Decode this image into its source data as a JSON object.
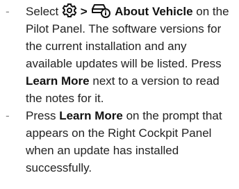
{
  "steps": [
    {
      "bullet": "-",
      "prefix": "Select",
      "icons": [
        "gear-icon",
        "car-info-icon"
      ],
      "separator": ">",
      "bold_label": "About Vehicle",
      "rest": "on the Pilot Panel. The software versions for the current installation and any available updates will be listed. Press",
      "bold_action": "Learn More",
      "suffix": "next to a version to read the notes for it."
    },
    {
      "bullet": "-",
      "prefix": "Press",
      "bold_action": "Learn More",
      "suffix": "on the prompt that appears on the Right Cockpit Panel when an update has installed successfully."
    }
  ],
  "colors": {
    "text": "#222222",
    "bullet": "#888888"
  }
}
